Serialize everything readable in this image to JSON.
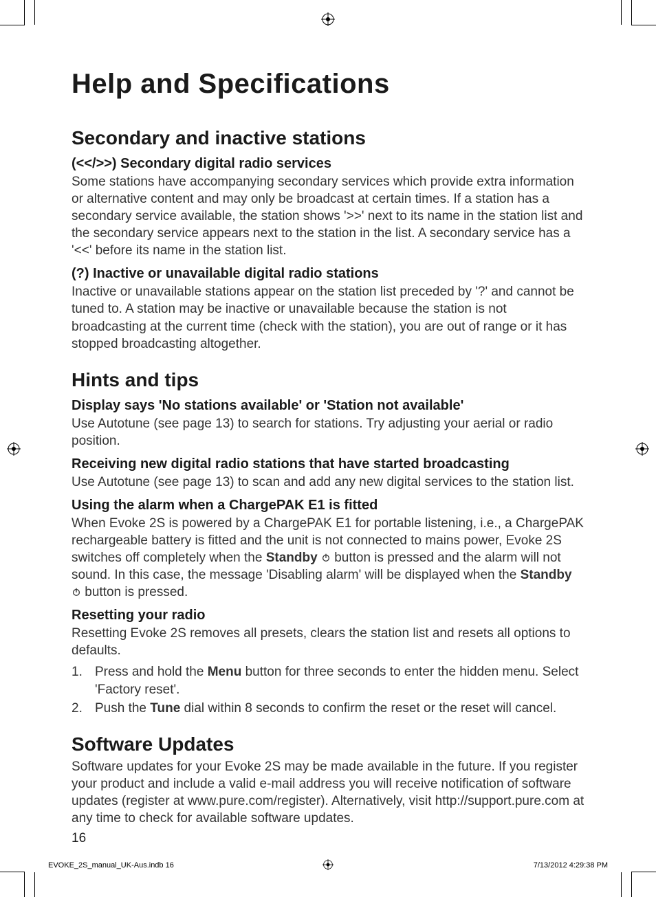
{
  "title": "Help and Specifications",
  "sections": {
    "secondary": {
      "heading": "Secondary and inactive stations",
      "sub1_title": "(<</>>) Secondary digital radio services",
      "sub1_body": "Some stations have accompanying secondary services which provide extra information or alternative content and may only be broadcast at certain times. If a station has a secondary service available, the station shows '>>' next to its name in the station list and the secondary service appears next to the station in the list. A secondary service has a '<<' before its name in the station list.",
      "sub2_title": "(?) Inactive or unavailable digital radio stations",
      "sub2_body": "Inactive or unavailable stations appear on the station list preceded by '?' and cannot be tuned to. A station may be inactive or unavailable because the station is not broadcasting at the current time (check with the station), you are out of range or it has stopped broadcasting altogether."
    },
    "hints": {
      "heading": "Hints and tips",
      "sub1_title": "Display says 'No stations available' or 'Station not available'",
      "sub1_body": "Use Autotune (see page 13) to search for stations. Try adjusting your aerial or radio position.",
      "sub2_title": "Receiving new digital radio stations that have started broadcasting",
      "sub2_body": "Use Autotune (see page 13) to scan and add any new digital services to the station list.",
      "sub3_title": "Using the alarm when a ChargePAK E1 is fitted",
      "sub3_body_1": "When Evoke 2S is powered by a ChargePAK E1 for portable listening, i.e., a ChargePAK rechargeable battery is fitted and the unit is not connected to mains power, Evoke 2S switches off completely when the ",
      "sub3_body_standby": "Standby",
      "sub3_body_2": " button is pressed and the alarm will not sound. In this case, the message 'Disabling alarm' will be displayed when the ",
      "sub3_body_3": " button is pressed.",
      "sub4_title": "Resetting your radio",
      "sub4_intro": "Resetting Evoke 2S removes all presets, clears the station list and resets all options to defaults.",
      "sub4_step1_num": "1.",
      "sub4_step1_a": "Press and hold the ",
      "sub4_step1_menu": "Menu",
      "sub4_step1_b": " button for three seconds to enter the hidden menu. Select 'Factory reset'.",
      "sub4_step2_num": "2.",
      "sub4_step2_a": "Push the ",
      "sub4_step2_tune": "Tune",
      "sub4_step2_b": " dial within 8 seconds to confirm the reset or the reset will cancel."
    },
    "software": {
      "heading": "Software Updates",
      "body": "Software updates for your Evoke 2S may be made available in the future. If you register your product and include a valid e-mail address you will receive notification of software updates (register at www.pure.com/register). Alternatively, visit http://support.pure.com at any time to check for available software updates."
    }
  },
  "page_number": "16",
  "footer": {
    "file": "EVOKE_2S_manual_UK-Aus.indb   16",
    "timestamp": "7/13/2012   4:29:38 PM"
  }
}
